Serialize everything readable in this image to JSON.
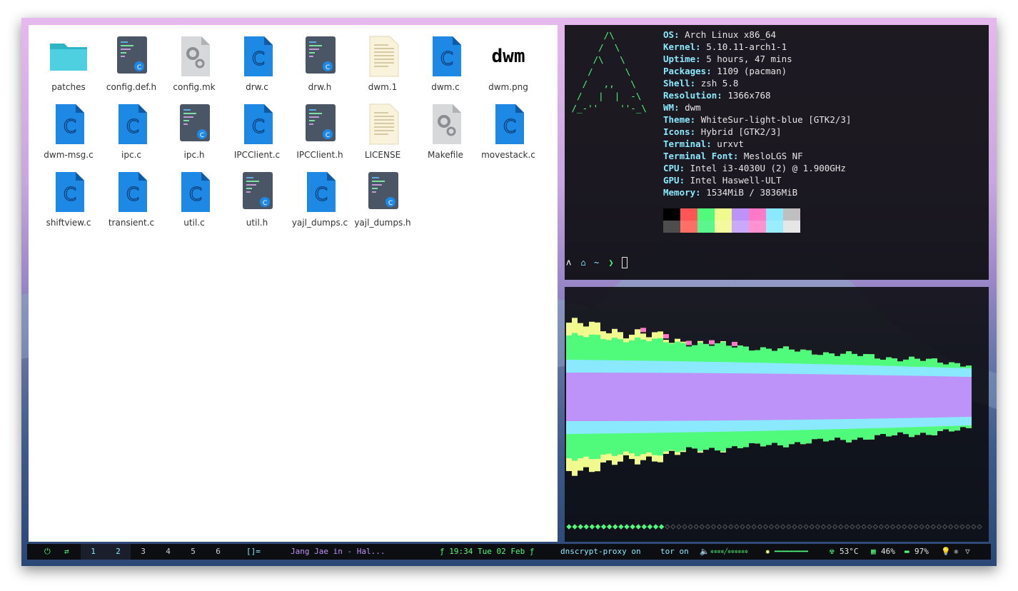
{
  "file_manager": {
    "files": [
      {
        "name": "patches",
        "type": "folder"
      },
      {
        "name": "config.def.h",
        "type": "header"
      },
      {
        "name": "config.mk",
        "type": "config"
      },
      {
        "name": "drw.c",
        "type": "c"
      },
      {
        "name": "drw.h",
        "type": "header"
      },
      {
        "name": "dwm.1",
        "type": "text"
      },
      {
        "name": "dwm.c",
        "type": "c"
      },
      {
        "name": "dwm.png",
        "type": "image"
      },
      {
        "name": "dwm-msg.c",
        "type": "c"
      },
      {
        "name": "ipc.c",
        "type": "c"
      },
      {
        "name": "ipc.h",
        "type": "header"
      },
      {
        "name": "IPCClient.c",
        "type": "c"
      },
      {
        "name": "IPCClient.h",
        "type": "header"
      },
      {
        "name": "LICENSE",
        "type": "text"
      },
      {
        "name": "Makefile",
        "type": "config"
      },
      {
        "name": "movestack.c",
        "type": "c"
      },
      {
        "name": "shiftview.c",
        "type": "c"
      },
      {
        "name": "transient.c",
        "type": "c"
      },
      {
        "name": "util.c",
        "type": "c"
      },
      {
        "name": "util.h",
        "type": "header"
      },
      {
        "name": "yajl_dumps.c",
        "type": "c"
      },
      {
        "name": "yajl_dumps.h",
        "type": "header"
      }
    ],
    "dwm_logo_text": "dwm",
    "c_icon_glyph": "C",
    "header_badge": "C"
  },
  "terminal": {
    "logo_lines": [
      "       /\\",
      "      /  \\",
      "     /\\   \\",
      "    /      \\",
      "   /   ,,   \\",
      "  /   |  |  -\\",
      " /_-''    ''-_\\"
    ],
    "info": [
      {
        "key": "OS",
        "value": "Arch Linux x86_64"
      },
      {
        "key": "Kernel",
        "value": "5.10.11-arch1-1"
      },
      {
        "key": "Uptime",
        "value": "5 hours, 47 mins"
      },
      {
        "key": "Packages",
        "value": "1109 (pacman)"
      },
      {
        "key": "Shell",
        "value": "zsh 5.8"
      },
      {
        "key": "Resolution",
        "value": "1366x768"
      },
      {
        "key": "WM",
        "value": "dwm"
      },
      {
        "key": "Theme",
        "value": "WhiteSur-light-blue [GTK2/3]"
      },
      {
        "key": "Icons",
        "value": "Hybrid [GTK2/3]"
      },
      {
        "key": "Terminal",
        "value": "urxvt"
      },
      {
        "key": "Terminal Font",
        "value": "MesloLGS NF"
      },
      {
        "key": "CPU",
        "value": "Intel i3-4030U (2) @ 1.900GHz"
      },
      {
        "key": "GPU",
        "value": "Intel Haswell-ULT"
      },
      {
        "key": "Memory",
        "value": "1534MiB / 3836MiB"
      }
    ],
    "palette_top": [
      "#000000",
      "#ff5555",
      "#50fa7b",
      "#f1fa8c",
      "#bd93f9",
      "#ff79c6",
      "#8be9fd",
      "#bfbfbf"
    ],
    "palette_bottom": [
      "#4d4d4d",
      "#ff6e67",
      "#5af78e",
      "#f4f99d",
      "#caa9fa",
      "#ff92d0",
      "#9aedfe",
      "#e6e6e6"
    ],
    "prompt": {
      "arch_glyph": "ʌ",
      "home_glyph": "⌂",
      "path": "~",
      "arrow": "❯"
    }
  },
  "visualizer": {
    "colors": {
      "purple": "#bd93f9",
      "cyan": "#8be9fd",
      "green": "#50fa7b",
      "yellow": "#f1fa8c",
      "pink": "#ff79c6"
    },
    "progress_filled": 17,
    "progress_total": 72
  },
  "statusbar": {
    "power_icon": "⏻",
    "refresh_icon": "⇄",
    "tags": [
      "1",
      "2",
      "3",
      "4",
      "5",
      "6"
    ],
    "layout": "[]=",
    "window_title": "Jang Jae in - Hal...",
    "clock": "ƒ 19:34 Tue 02 Feb ƒ",
    "dnscrypt": "dnscrypt-proxy on",
    "tor": "tor on",
    "volume_icon": "🔈",
    "volume_meter": "✲✲✲✲╱✲✲✲✲✲✲",
    "brightness_icon": "✹",
    "brightness_meter": "▬▬▬▬▬▬▬▬▬▬▬▬▬",
    "temp_icon": "☢",
    "temp": "53°C",
    "cpu_icon": "▦",
    "cpu": "46%",
    "battery_icon": "▬",
    "battery": "97%",
    "extra_icons": [
      "💡",
      "✱",
      "▽"
    ]
  }
}
